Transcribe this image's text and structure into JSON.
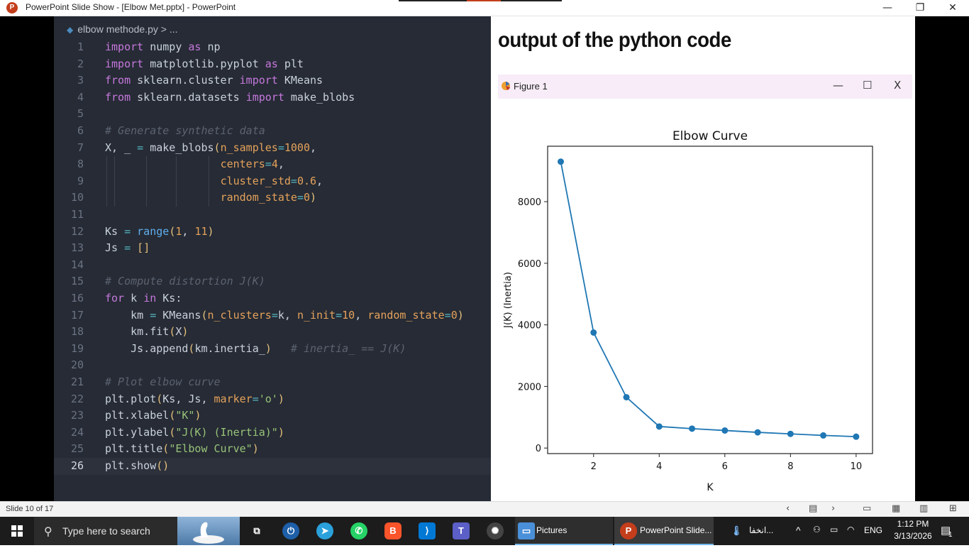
{
  "window": {
    "title": "PowerPoint Slide Show - [Elbow Met.pptx] - PowerPoint",
    "minimize": "—",
    "maximize": "❐",
    "close": "✕"
  },
  "editor": {
    "breadcrumb": "elbow methode.py > ...",
    "lines": [
      {
        "n": "1",
        "src": "import numpy as np"
      },
      {
        "n": "2",
        "src": "import matplotlib.pyplot as plt"
      },
      {
        "n": "3",
        "src": "from sklearn.cluster import KMeans"
      },
      {
        "n": "4",
        "src": "from sklearn.datasets import make_blobs"
      },
      {
        "n": "5",
        "src": ""
      },
      {
        "n": "6",
        "src": "# Generate synthetic data"
      },
      {
        "n": "7",
        "src": "X, _ = make_blobs(n_samples=1000,"
      },
      {
        "n": "8",
        "src": "                  centers=4,"
      },
      {
        "n": "9",
        "src": "                  cluster_std=0.6,"
      },
      {
        "n": "10",
        "src": "                  random_state=0)"
      },
      {
        "n": "11",
        "src": ""
      },
      {
        "n": "12",
        "src": "Ks = range(1, 11)"
      },
      {
        "n": "13",
        "src": "Js = []"
      },
      {
        "n": "14",
        "src": ""
      },
      {
        "n": "15",
        "src": "# Compute distortion J(K)"
      },
      {
        "n": "16",
        "src": "for k in Ks:"
      },
      {
        "n": "17",
        "src": "    km = KMeans(n_clusters=k, n_init=10, random_state=0)"
      },
      {
        "n": "18",
        "src": "    km.fit(X)"
      },
      {
        "n": "19",
        "src": "    Js.append(km.inertia_)   # inertia_ == J(K)"
      },
      {
        "n": "20",
        "src": ""
      },
      {
        "n": "21",
        "src": "# Plot elbow curve"
      },
      {
        "n": "22",
        "src": "plt.plot(Ks, Js, marker='o')"
      },
      {
        "n": "23",
        "src": "plt.xlabel(\"K\")"
      },
      {
        "n": "24",
        "src": "plt.ylabel(\"J(K) (Inertia)\")"
      },
      {
        "n": "25",
        "src": "plt.title(\"Elbow Curve\")"
      },
      {
        "n": "26",
        "src": "plt.show()"
      }
    ]
  },
  "slide": {
    "heading": "output of the python code",
    "figure_title": "Figure 1",
    "fig_minimize": "—",
    "fig_maximize": "☐",
    "fig_close": "X"
  },
  "chart_data": {
    "type": "line",
    "title": "Elbow Curve",
    "xlabel": "K",
    "ylabel": "J(K) (Inertia)",
    "x": [
      1,
      2,
      3,
      4,
      5,
      6,
      7,
      8,
      9,
      10
    ],
    "series": [
      {
        "values": [
          9300,
          3750,
          1650,
          700,
          630,
          570,
          510,
          460,
          410,
          370
        ]
      }
    ],
    "xlim": [
      0.6,
      10.5
    ],
    "ylim": [
      -180,
      9800
    ],
    "xticks": [
      2,
      4,
      6,
      8,
      10
    ],
    "yticks": [
      0,
      2000,
      4000,
      6000,
      8000
    ],
    "grid": false,
    "line_color": "#1f77b4"
  },
  "statusbar": {
    "slide_count": "Slide 10 of 17"
  },
  "taskbar": {
    "search_placeholder": "Type here to search",
    "apps": [
      {
        "label": "Pictures"
      },
      {
        "label": "PowerPoint Slide..."
      },
      {
        "label": "انخفا..."
      }
    ],
    "language": "ENG",
    "time": "1:12 PM",
    "date": "3/13/2026",
    "notification_count": "1"
  }
}
